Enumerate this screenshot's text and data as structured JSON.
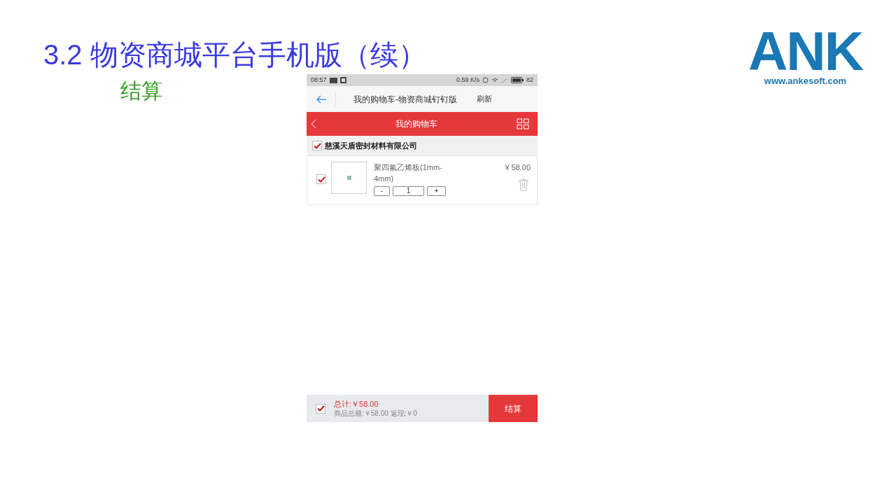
{
  "slide": {
    "title": "3.2 物资商城平台手机版（续）",
    "subtitle": "结算",
    "logo": {
      "mark": "ANK",
      "url": "www.ankesoft.com"
    }
  },
  "phone": {
    "status_bar": {
      "time": "08:57",
      "speed": "0.59 K/s",
      "battery": "82"
    },
    "app_bar": {
      "title": "我的购物车-物资商城钉钉版",
      "action": "刷新"
    },
    "page_header": {
      "title": "我的购物车"
    },
    "shops": [
      {
        "name": "慈溪天盾密封材料有限公司",
        "checked": true,
        "items": [
          {
            "name": "聚四氟乙烯板(1mm-4mm)",
            "price": "￥58.00",
            "quantity": "1",
            "decrement": "-",
            "increment": "+",
            "checked": true
          }
        ]
      }
    ],
    "footer": {
      "checked": true,
      "total": "总计:￥58.00",
      "detail": "商品总额:￥58.00 返现:￥0",
      "checkout": "结算"
    }
  }
}
